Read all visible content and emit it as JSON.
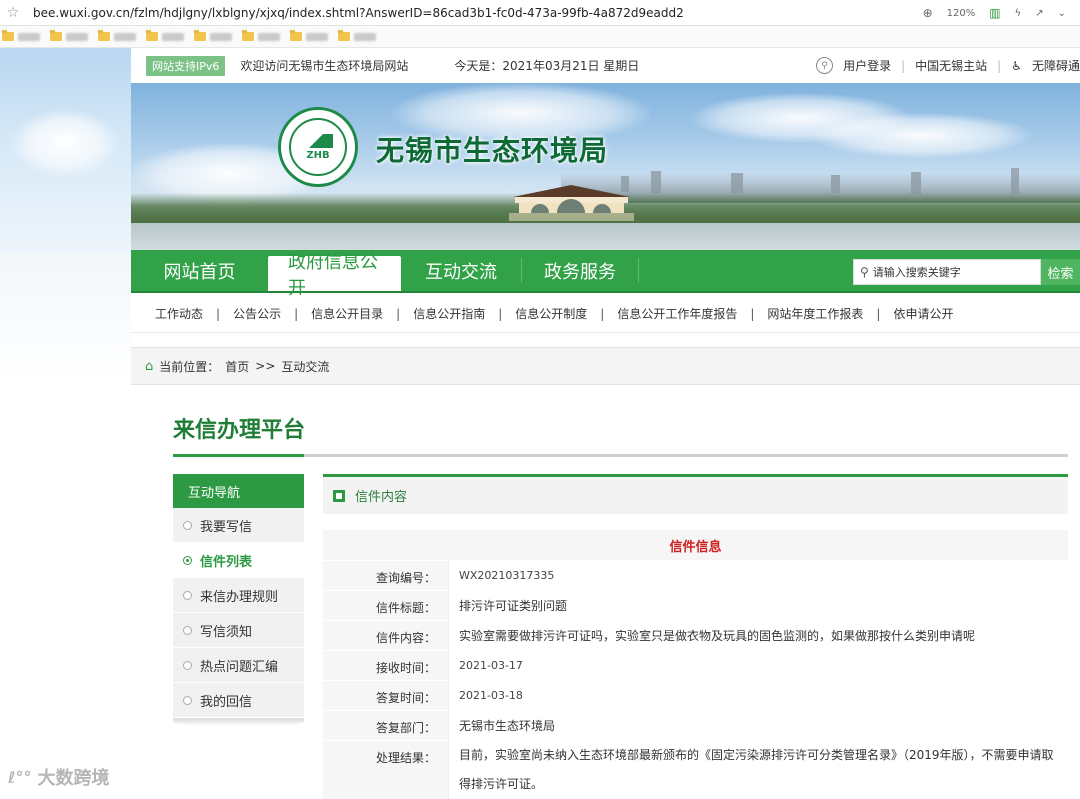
{
  "browser": {
    "url": "bee.wuxi.gov.cn/fzlm/hdjlgny/lxblgny/xjxq/index.shtml?AnswerID=86cad3b1-fc0d-473a-99fb-4a872d9eadd2",
    "zoom": "120%"
  },
  "topbar": {
    "ipv6": "网站支持IPv6",
    "welcome": "欢迎访问无锡市生态环境局网站",
    "today": "今天是：2021年03月21日 星期日",
    "login": "用户登录",
    "portal": "中国无锡主站",
    "accessibility": "无障碍通"
  },
  "banner": {
    "title": "无锡市生态环境局",
    "logo_text": "ZHB"
  },
  "nav": {
    "items": [
      "网站首页",
      "政府信息公开",
      "互动交流",
      "政务服务"
    ],
    "search_placeholder": "请输入搜索关键字",
    "search_button": "检索"
  },
  "subnav": {
    "items": [
      "工作动态",
      "公告公示",
      "信息公开目录",
      "信息公开指南",
      "信息公开制度",
      "信息公开工作年度报告",
      "网站年度工作报表",
      "依申请公开"
    ],
    "sep": "|"
  },
  "breadcrumb": {
    "prefix": "当前位置：",
    "home": "首页",
    "sep": ">>",
    "current": "互动交流"
  },
  "platform_title": "来信办理平台",
  "sidebar": {
    "heading": "互动导航",
    "items": [
      "我要写信",
      "信件列表",
      "来信办理规则",
      "写信须知",
      "热点问题汇编",
      "我的回信"
    ],
    "active_index": 1
  },
  "content": {
    "heading": "信件内容",
    "caption": "信件信息",
    "rows": [
      {
        "label": "查询编号：",
        "value": "WX20210317335"
      },
      {
        "label": "信件标题：",
        "value": "排污许可证类别问题"
      },
      {
        "label": "信件内容：",
        "value": "实验室需要做排污许可证吗，实验室只是做衣物及玩具的固色监测的，如果做那按什么类别申请呢"
      },
      {
        "label": "接收时间：",
        "value": "2021-03-17"
      },
      {
        "label": "答复时间：",
        "value": "2021-03-18"
      },
      {
        "label": "答复部门：",
        "value": "无锡市生态环境局"
      },
      {
        "label": "处理结果：",
        "value": "目前，实验室尚未纳入生态环境部最新颁布的《固定污染源排污许可分类管理名录》（2019年版），不需要申请取得排污许可证。"
      }
    ]
  },
  "watermark": "大数跨境",
  "colors": {
    "brand_green": "#31a248",
    "accent_red": "#d02020"
  }
}
